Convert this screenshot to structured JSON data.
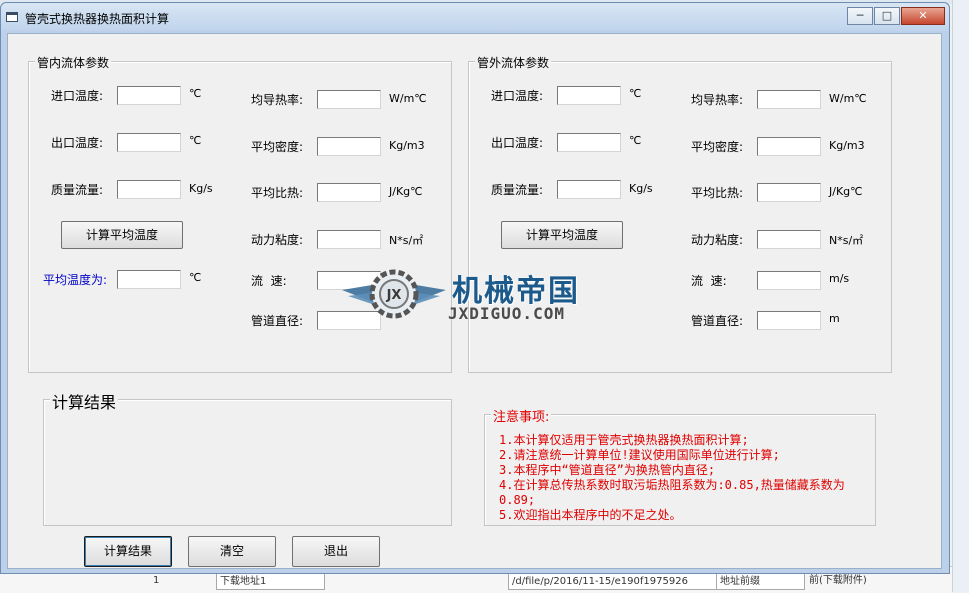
{
  "window": {
    "title": "管壳式换热器换热面积计算",
    "controls": {
      "minimize": "─",
      "maximize": "□",
      "close": "✕"
    }
  },
  "inner_group": {
    "legend": "管内流体参数",
    "inlet_temp": {
      "label": "进口温度:",
      "unit": "℃",
      "value": ""
    },
    "outlet_temp": {
      "label": "出口温度:",
      "unit": "℃",
      "value": ""
    },
    "mass_flow": {
      "label": "质量流量:",
      "unit": "Kg/s",
      "value": ""
    },
    "calc_avg_button": "计算平均温度",
    "avg_temp": {
      "label": "平均温度为:",
      "unit": "℃",
      "value": ""
    },
    "conductivity": {
      "label": "均导热率:",
      "unit": "W/m℃",
      "value": ""
    },
    "density": {
      "label": "平均密度:",
      "unit": "Kg/m3",
      "value": ""
    },
    "specific_heat": {
      "label": "平均比热:",
      "unit": "J/Kg℃",
      "value": ""
    },
    "viscosity": {
      "label": "动力粘度:",
      "unit": "N*s/㎡",
      "value": ""
    },
    "velocity": {
      "label": "流  速:",
      "value": ""
    },
    "pipe_diameter": {
      "label": "管道直径:",
      "value": ""
    }
  },
  "outer_group": {
    "legend": "管外流体参数",
    "inlet_temp": {
      "label": "进口温度:",
      "unit": "℃",
      "value": ""
    },
    "outlet_temp": {
      "label": "出口温度:",
      "unit": "℃",
      "value": ""
    },
    "mass_flow": {
      "label": "质量流量:",
      "unit": "Kg/s",
      "value": ""
    },
    "calc_avg_button": "计算平均温度",
    "conductivity": {
      "label": "均导热率:",
      "unit": "W/m℃",
      "value": ""
    },
    "density": {
      "label": "平均密度:",
      "unit": "Kg/m3",
      "value": ""
    },
    "specific_heat": {
      "label": "平均比热:",
      "unit": "J/Kg℃",
      "value": ""
    },
    "viscosity": {
      "label": "动力粘度:",
      "unit": "N*s/㎡",
      "value": ""
    },
    "velocity": {
      "label": "流  速:",
      "unit": "m/s",
      "value": ""
    },
    "pipe_diameter": {
      "label": "管道直径:",
      "unit": "m",
      "value": ""
    }
  },
  "results": {
    "legend": "计算结果"
  },
  "notes": {
    "legend": "注意事项:",
    "items": [
      "1.本计算仅适用于管壳式换热器换热面积计算;",
      "2.请注意统一计算单位!建议使用国际单位进行计算;",
      "3.本程序中“管道直径”为换热管内直径;",
      "4.在计算总传热系数时取污垢热阻系数为:0.85,热量储藏系数为0.89;",
      "5.欢迎指出本程序中的不足之处。"
    ]
  },
  "buttons": {
    "calculate": "计算结果",
    "clear": "清空",
    "exit": "退出"
  },
  "watermark": {
    "logo_text": "JX",
    "title": "机械帝国",
    "subtitle": "JXDIGUO.COM"
  },
  "background_taskbar": {
    "cells": [
      "1",
      "下载地址1",
      "/d/file/p/2016/11-15/e190f1975926",
      "地址前缀",
      "前(下载附件)"
    ]
  },
  "colors": {
    "notes_text": "#e00000",
    "avg_label": "#0000c8",
    "watermark_blue": "#1d5a8c"
  }
}
